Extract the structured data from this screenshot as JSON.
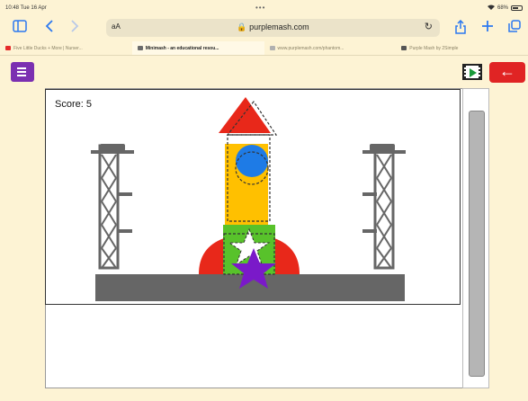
{
  "status_bar": {
    "time": "10:48 Tue 16 Apr",
    "dots": "•••",
    "battery": "68%"
  },
  "browser": {
    "text_size": "aA",
    "url": "🔒 purplemash.com",
    "tabs": [
      {
        "label": "Five Little Ducks + More | Nurser...",
        "favicon_color": "#e52a2a",
        "active": false
      },
      {
        "label": "Minimash - an educational resou...",
        "favicon_color": "#6b6b6b",
        "active": true
      },
      {
        "label": "www.purplemash.com/phantom...",
        "favicon_color": "#b0b0b0",
        "active": false
      },
      {
        "label": "Purple Mash by 2Simple",
        "favicon_color": "#555555",
        "active": false
      }
    ]
  },
  "app": {
    "menu_icon": "menu-icon",
    "play_icon": "play-video-icon",
    "back_icon": "back-arrow-icon",
    "back_label": "←",
    "accent_purple": "#7b2fb1",
    "accent_red": "#e02424"
  },
  "game": {
    "score_text": "Score:  5",
    "shapes": {
      "nose_color": "#e8281a",
      "body_color": "#ffc000",
      "window_color": "#1e7be6",
      "square_color": "#58c22b",
      "star_color": "#7a19c9",
      "fin_color": "#e8281a",
      "pad_color": "#666666"
    }
  }
}
